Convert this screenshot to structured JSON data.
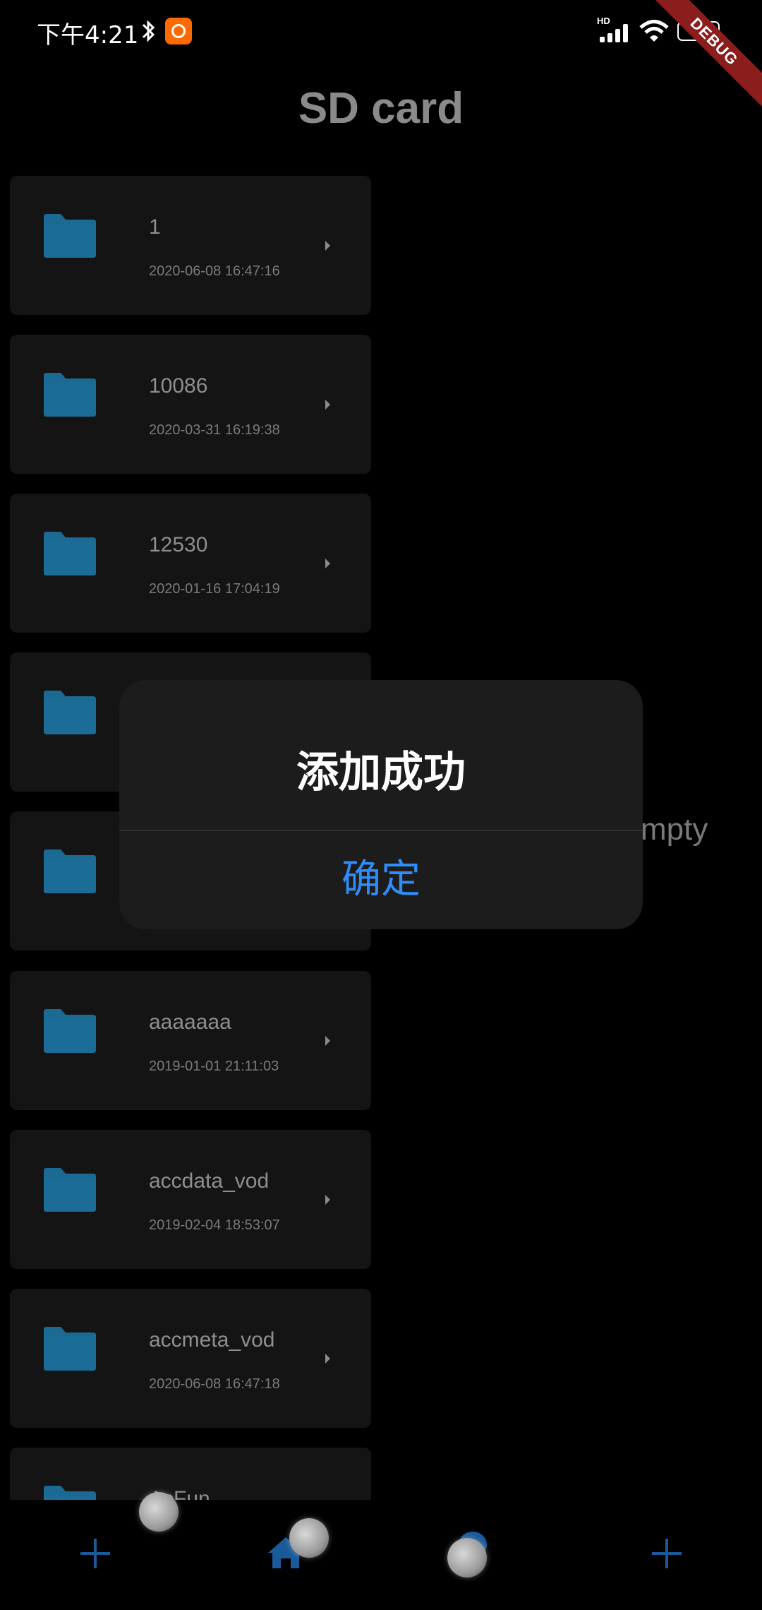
{
  "status_bar": {
    "time": "下午4:21",
    "hd": "HD",
    "battery": "64"
  },
  "debug_banner": "DEBUG",
  "title": "SD card",
  "files": [
    {
      "name": "1",
      "date": "2020-06-08 16:47:16"
    },
    {
      "name": "10086",
      "date": "2020-03-31 16:19:38"
    },
    {
      "name": "12530",
      "date": "2020-01-16 17:04:19"
    },
    {
      "name": "",
      "date": ""
    },
    {
      "name": "",
      "date": ""
    },
    {
      "name": "aaaaaaa",
      "date": "2019-01-01 21:11:03"
    },
    {
      "name": "accdata_vod",
      "date": "2019-02-04 18:53:07"
    },
    {
      "name": "accmeta_vod",
      "date": "2020-06-08 16:47:18"
    },
    {
      "name": "AcFun",
      "date": ""
    }
  ],
  "empty_text": "mpty",
  "dialog": {
    "title": "添加成功",
    "confirm": "确定"
  },
  "colors": {
    "folder": "#1a6a93",
    "accent": "#2f8df7",
    "nav_icon": "#1a5a9a"
  },
  "icons": {
    "nav": [
      "plus-icon",
      "home-icon",
      "location-pin-icon",
      "plus-icon"
    ]
  }
}
